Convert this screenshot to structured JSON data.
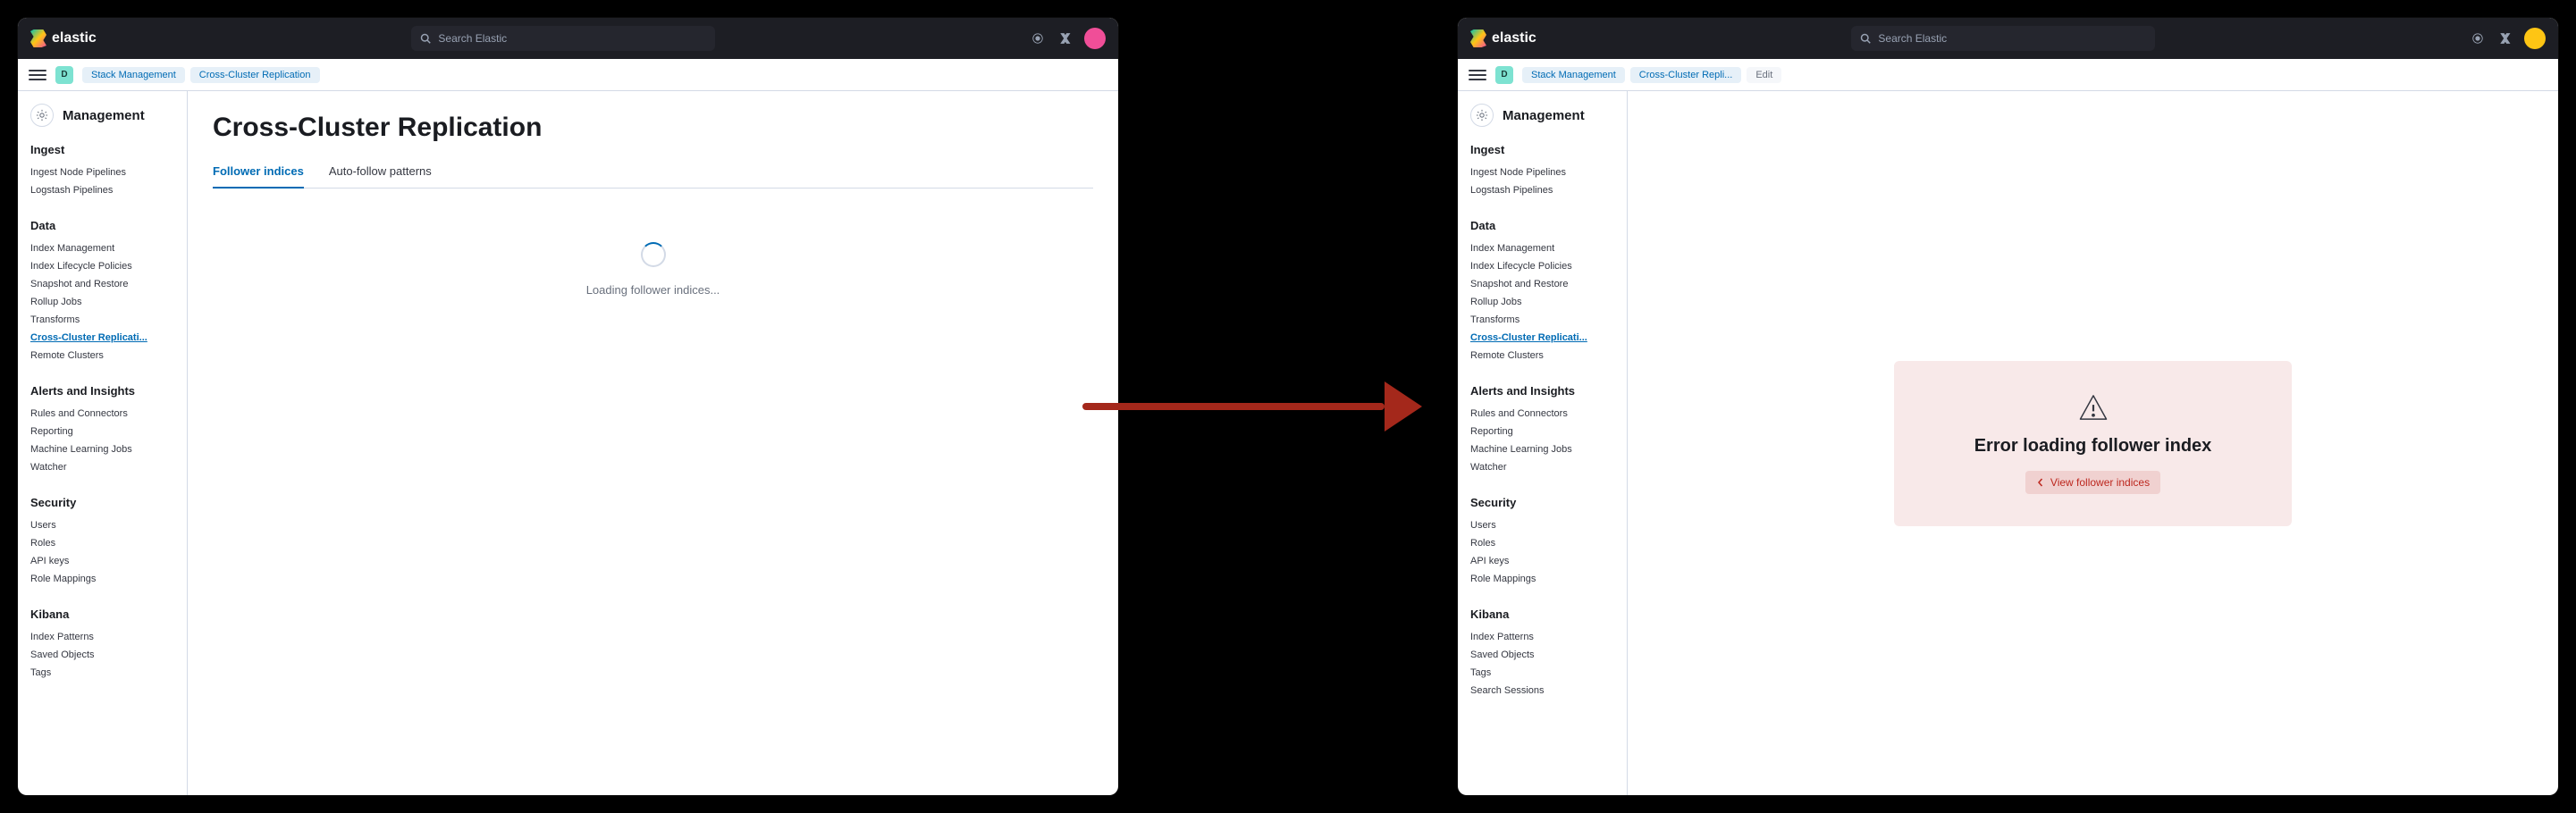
{
  "brand": "elastic",
  "search_placeholder": "Search Elastic",
  "avatar_bg_left": "#f04e98",
  "avatar_bg_right": "#fec514",
  "space_letter": "D",
  "breadcrumbs_left": [
    "Stack Management",
    "Cross-Cluster Replication"
  ],
  "breadcrumbs_right": [
    "Stack Management",
    "Cross-Cluster Repli...",
    "Edit"
  ],
  "sidebar": {
    "title": "Management",
    "groups": [
      {
        "title": "Ingest",
        "items": [
          "Ingest Node Pipelines",
          "Logstash Pipelines"
        ]
      },
      {
        "title": "Data",
        "items": [
          "Index Management",
          "Index Lifecycle Policies",
          "Snapshot and Restore",
          "Rollup Jobs",
          "Transforms",
          "Cross-Cluster Replicati...",
          "Remote Clusters"
        ],
        "active_index": 5
      },
      {
        "title": "Alerts and Insights",
        "items": [
          "Rules and Connectors",
          "Reporting",
          "Machine Learning Jobs",
          "Watcher"
        ]
      },
      {
        "title": "Security",
        "items": [
          "Users",
          "Roles",
          "API keys",
          "Role Mappings"
        ]
      },
      {
        "title": "Kibana",
        "items": [
          "Index Patterns",
          "Saved Objects",
          "Tags",
          "Search Sessions"
        ]
      }
    ]
  },
  "left_panel": {
    "title": "Cross-Cluster Replication",
    "tabs": [
      "Follower indices",
      "Auto-follow patterns"
    ],
    "active_tab": 0,
    "loading_text": "Loading follower indices..."
  },
  "right_panel": {
    "error_title": "Error loading follower index",
    "error_button": "View follower indices"
  },
  "sidebar_left_visible_groups": 5,
  "sidebar_left_kibana_items_visible": 2
}
